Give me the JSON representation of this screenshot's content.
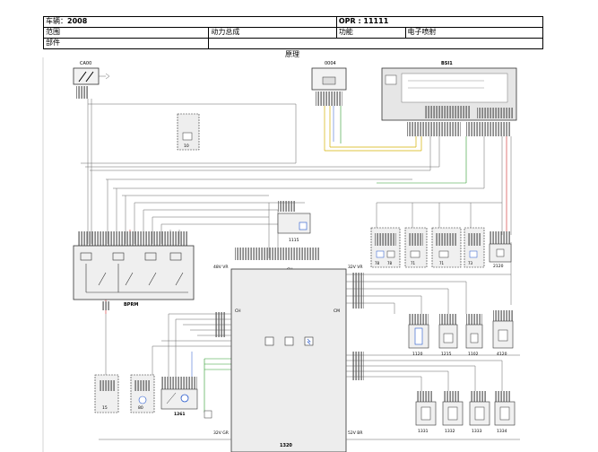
{
  "header": {
    "vehicle_label": "车辆：",
    "vehicle_value": "2008",
    "opr_label": "OPR : ",
    "opr_value": "11111",
    "scope_label": "范围",
    "scope_value": "动力总成",
    "function_label": "功能",
    "function_value": "电子喷射",
    "parts_label": "部件"
  },
  "title": "原理",
  "components": {
    "ca00": "CA00",
    "c0004": "0004",
    "bsi1": "BSI1",
    "bpbm": "BPRM",
    "ecu": "1320",
    "c1115": "1115",
    "c2120": "2120",
    "c1120": "1120",
    "c1215": "1215",
    "c1102": "1102",
    "c4120": "4120",
    "c1331": "1331",
    "c1332": "1332",
    "c1333": "1333",
    "c1334": "1334",
    "c1261": "1261",
    "c15": "15",
    "c80": "80",
    "c10": "10",
    "c78a": "78",
    "c78b": "78",
    "c71a": "71",
    "c71b": "71",
    "c73": "73"
  },
  "connector_labels": {
    "ch": "CH",
    "cm": "CM",
    "vr48": "48V VR",
    "vr32": "32V VR",
    "vr_gr": "32V GR",
    "vr_br": "52V BR"
  }
}
